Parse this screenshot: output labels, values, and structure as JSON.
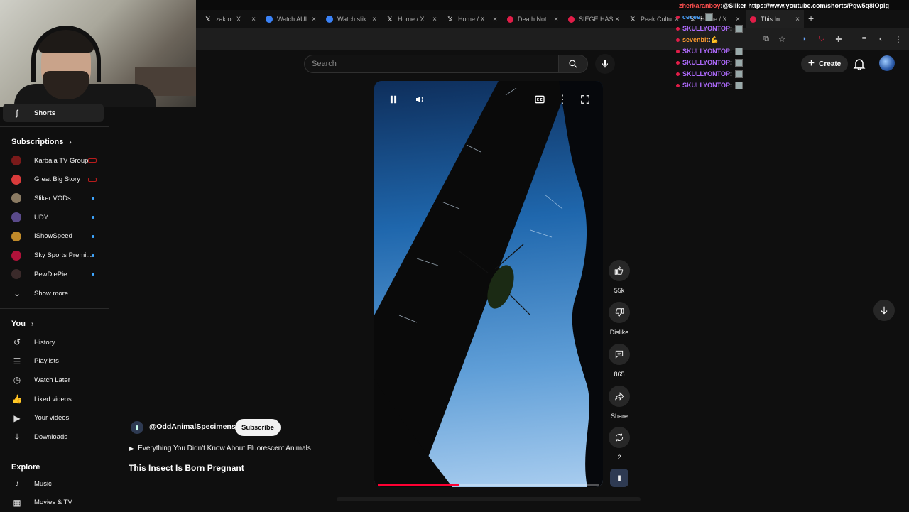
{
  "browser": {
    "tabs": [
      {
        "label": "zak on X: ",
        "icon": "x"
      },
      {
        "label": "Watch AUI",
        "icon": "lens"
      },
      {
        "label": "Watch slik",
        "icon": "lens"
      },
      {
        "label": "Home / X",
        "icon": "x"
      },
      {
        "label": "Home / X",
        "icon": "x"
      },
      {
        "label": "Death Not",
        "icon": "yt"
      },
      {
        "label": "SIEGE HAS",
        "icon": "yt"
      },
      {
        "label": "Peak Cultu",
        "icon": "x"
      },
      {
        "label": "Home / X",
        "icon": "x"
      },
      {
        "label": "This In",
        "icon": "yt",
        "active": true
      }
    ],
    "new_tab": "+"
  },
  "chat": [
    {
      "user": "zherkaranboy",
      "color": "#ff4f4f",
      "msg": "@Sliker https://www.youtube.com/shorts/Pgw5q8IOpig"
    },
    {
      "user": "cecee",
      "color": "#4aa3ff",
      "msg": "",
      "emote": true
    },
    {
      "user": "SKULLYONTOP",
      "color": "#b06bff",
      "msg": "",
      "emote": true
    },
    {
      "user": "sevenbit",
      "color": "#ff9b2f",
      "msg": "💪",
      "emote": false
    },
    {
      "user": "SKULLYONTOP",
      "color": "#b06bff",
      "msg": "",
      "emote": true
    },
    {
      "user": "SKULLYONTOP",
      "color": "#b06bff",
      "msg": "",
      "emote": true
    },
    {
      "user": "SKULLYONTOP",
      "color": "#b06bff",
      "msg": "",
      "emote": true
    },
    {
      "user": "SKULLYONTOP",
      "color": "#b06bff",
      "msg": "",
      "emote": true
    }
  ],
  "header": {
    "search_placeholder": "Search",
    "create_label": "Create"
  },
  "sidebar": {
    "shorts": "Shorts",
    "subscriptions_heading": "Subscriptions",
    "subscriptions": [
      {
        "label": "Karbala TV Group",
        "status": "live",
        "color": "#7a1a1a"
      },
      {
        "label": "Great Big Story",
        "status": "live",
        "color": "#d93b3b"
      },
      {
        "label": "Sliker VODs",
        "status": "new",
        "color": "#8a7a62"
      },
      {
        "label": "UDY",
        "status": "new",
        "color": "#5a4a8a"
      },
      {
        "label": "IShowSpeed",
        "status": "new",
        "color": "#c08a2a"
      },
      {
        "label": "Sky Sports Premi...",
        "status": "new",
        "color": "#b0123a"
      },
      {
        "label": "PewDiePie",
        "status": "new",
        "color": "#3a2a2a"
      }
    ],
    "show_more": "Show more",
    "you_heading": "You",
    "you_items": [
      {
        "label": "History",
        "icon": "history-icon"
      },
      {
        "label": "Playlists",
        "icon": "playlists-icon"
      },
      {
        "label": "Watch Later",
        "icon": "watch-later-icon"
      },
      {
        "label": "Liked videos",
        "icon": "thumbs-up-icon"
      },
      {
        "label": "Your videos",
        "icon": "your-videos-icon"
      },
      {
        "label": "Downloads",
        "icon": "download-icon"
      }
    ],
    "explore_heading": "Explore",
    "explore_items": [
      {
        "label": "Music",
        "icon": "music-icon"
      },
      {
        "label": "Movies & TV",
        "icon": "movies-icon"
      }
    ]
  },
  "video": {
    "progress_fraction": 0.37,
    "likes": "55k",
    "dislike_label": "Dislike",
    "comments": "865",
    "share_label": "Share",
    "remix_count": "2"
  },
  "channel": {
    "handle": "@OddAnimalSpecimens",
    "subscribe_label": "Subscribe",
    "playlist": "Everything You Didn't Know About Fluorescent Animals",
    "title": "This Insect Is Born Pregnant"
  }
}
